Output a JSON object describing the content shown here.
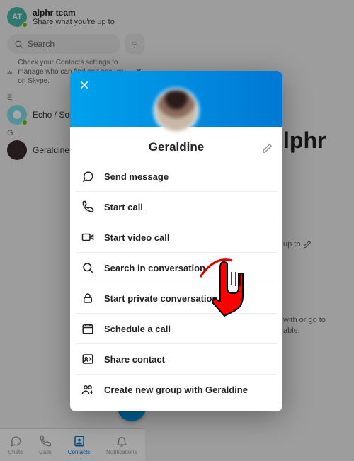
{
  "header": {
    "avatar_initials": "AT",
    "team_name": "alphr team",
    "status_text": "Share what you're up to"
  },
  "search": {
    "placeholder": "Search"
  },
  "notice": {
    "text": "Check your Contacts settings to manage who can find and see you on Skype."
  },
  "sections": {
    "E": {
      "letter": "E",
      "contact": "Echo / Sou"
    },
    "G": {
      "letter": "G",
      "contact": "Geraldine A"
    }
  },
  "main_panel": {
    "title": "lphr",
    "share_hint": "up to",
    "text1": "with or go to",
    "text2": "able."
  },
  "tabs": {
    "chats": "Chats",
    "calls": "Calls",
    "contacts": "Contacts",
    "notifications": "Notifications"
  },
  "profile_modal": {
    "name": "Geraldine",
    "menu": {
      "send_message": "Send message",
      "start_call": "Start call",
      "start_video": "Start video call",
      "search_conv": "Search in conversation",
      "private_conv": "Start private conversation",
      "schedule": "Schedule a call",
      "share": "Share contact",
      "create_group": "Create new group with Geraldine"
    }
  }
}
